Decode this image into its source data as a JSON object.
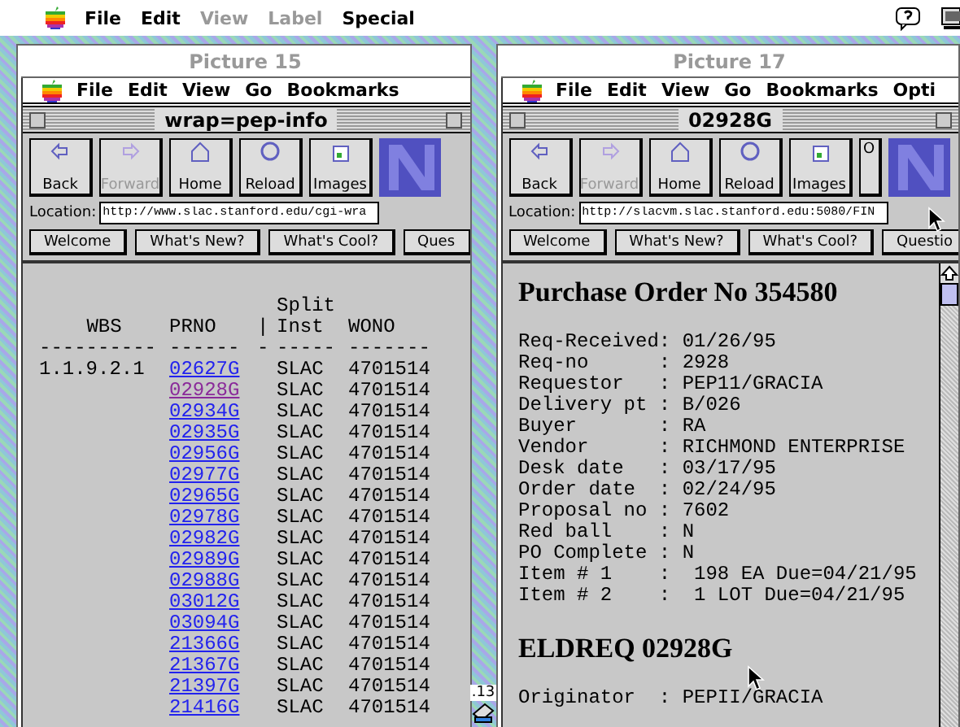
{
  "menu_bar": {
    "items": [
      {
        "label": "File",
        "disabled": false
      },
      {
        "label": "Edit",
        "disabled": false
      },
      {
        "label": "View",
        "disabled": true
      },
      {
        "label": "Label",
        "disabled": true
      },
      {
        "label": "Special",
        "disabled": false
      }
    ]
  },
  "windows": [
    {
      "title": "Picture 15",
      "menu": [
        "File",
        "Edit",
        "View",
        "Go",
        "Bookmarks"
      ],
      "page_title": "wrap=pep-info",
      "toolbar": [
        {
          "label": "Back",
          "disabled": false
        },
        {
          "label": "Forward",
          "disabled": true
        },
        {
          "label": "Home",
          "disabled": false
        },
        {
          "label": "Reload",
          "disabled": false
        },
        {
          "label": "Images",
          "disabled": false
        }
      ],
      "location_label": "Location:",
      "location": "http://www.slac.stanford.edu/cgi-wra",
      "directory": [
        "Welcome",
        "What's New?",
        "What's Cool?",
        "Ques"
      ],
      "page": {
        "kind": "table",
        "columns": [
          {
            "label": "WBS",
            "rule": "----------"
          },
          {
            "label": "PRNO",
            "rule": "------"
          },
          {
            "label": "|",
            "rule": "-"
          },
          {
            "label": "Inst",
            "above": "Split",
            "rule": "-----"
          },
          {
            "label": "WONO",
            "rule": "-------"
          }
        ],
        "rows": [
          {
            "wbs": "1.1.9.2.1",
            "prno": "02627G",
            "visited": false,
            "inst": "SLAC",
            "wono": "4701514"
          },
          {
            "prno": "02928G",
            "visited": true,
            "inst": "SLAC",
            "wono": "4701514"
          },
          {
            "prno": "02934G",
            "visited": false,
            "inst": "SLAC",
            "wono": "4701514"
          },
          {
            "prno": "02935G",
            "visited": false,
            "inst": "SLAC",
            "wono": "4701514"
          },
          {
            "prno": "02956G",
            "visited": false,
            "inst": "SLAC",
            "wono": "4701514"
          },
          {
            "prno": "02977G",
            "visited": false,
            "inst": "SLAC",
            "wono": "4701514"
          },
          {
            "prno": "02965G",
            "visited": false,
            "inst": "SLAC",
            "wono": "4701514"
          },
          {
            "prno": "02978G",
            "visited": false,
            "inst": "SLAC",
            "wono": "4701514"
          },
          {
            "prno": "02982G",
            "visited": false,
            "inst": "SLAC",
            "wono": "4701514"
          },
          {
            "prno": "02989G",
            "visited": false,
            "inst": "SLAC",
            "wono": "4701514"
          },
          {
            "prno": "02988G",
            "visited": false,
            "inst": "SLAC",
            "wono": "4701514"
          },
          {
            "prno": "03012G",
            "visited": false,
            "inst": "SLAC",
            "wono": "4701514"
          },
          {
            "prno": "03094G",
            "visited": false,
            "inst": "SLAC",
            "wono": "4701514"
          },
          {
            "prno": "21366G",
            "visited": false,
            "inst": "SLAC",
            "wono": "4701514"
          },
          {
            "prno": "21367G",
            "visited": false,
            "inst": "SLAC",
            "wono": "4701514"
          },
          {
            "prno": "21397G",
            "visited": false,
            "inst": "SLAC",
            "wono": "4701514"
          },
          {
            "prno": "21416G",
            "visited": false,
            "inst": "SLAC",
            "wono": "4701514"
          }
        ]
      }
    },
    {
      "title": "Picture 17",
      "menu": [
        "File",
        "Edit",
        "View",
        "Go",
        "Bookmarks",
        "Opti"
      ],
      "page_title": "02928G",
      "toolbar": [
        {
          "label": "Back",
          "disabled": false
        },
        {
          "label": "Forward",
          "disabled": true
        },
        {
          "label": "Home",
          "disabled": false
        },
        {
          "label": "Reload",
          "disabled": false
        },
        {
          "label": "Images",
          "disabled": false
        },
        {
          "label": "O",
          "disabled": false
        }
      ],
      "location_label": "Location:",
      "location": "http://slacvm.slac.stanford.edu:5080/FIN",
      "directory": [
        "Welcome",
        "What's New?",
        "What's Cool?",
        "Questio"
      ],
      "page": {
        "kind": "document",
        "blocks": [
          {
            "kind": "heading",
            "text": "Purchase Order No 354580"
          },
          {
            "kind": "fields",
            "lines": [
              "Req-Received: 01/26/95",
              "Req-no      : 2928",
              "Requestor   : PEP11/GRACIA",
              "Delivery pt : B/026",
              "Buyer       : RA",
              "Vendor      : RICHMOND ENTERPRISE",
              "Desk date   : 03/17/95",
              "Order date  : 02/24/95",
              "Proposal no : 7602",
              "Red ball    : N",
              "PO Complete : N",
              "Item # 1    :  198 EA Due=04/21/95",
              "Item # 2    :  1 LOT Due=04/21/95"
            ]
          },
          {
            "kind": "heading",
            "text": "ELDREQ 02928G"
          },
          {
            "kind": "fields",
            "lines": [
              "Originator  : PEPII/GRACIA"
            ]
          }
        ]
      }
    }
  ],
  "desktop_icon": {
    "label": ".13"
  }
}
